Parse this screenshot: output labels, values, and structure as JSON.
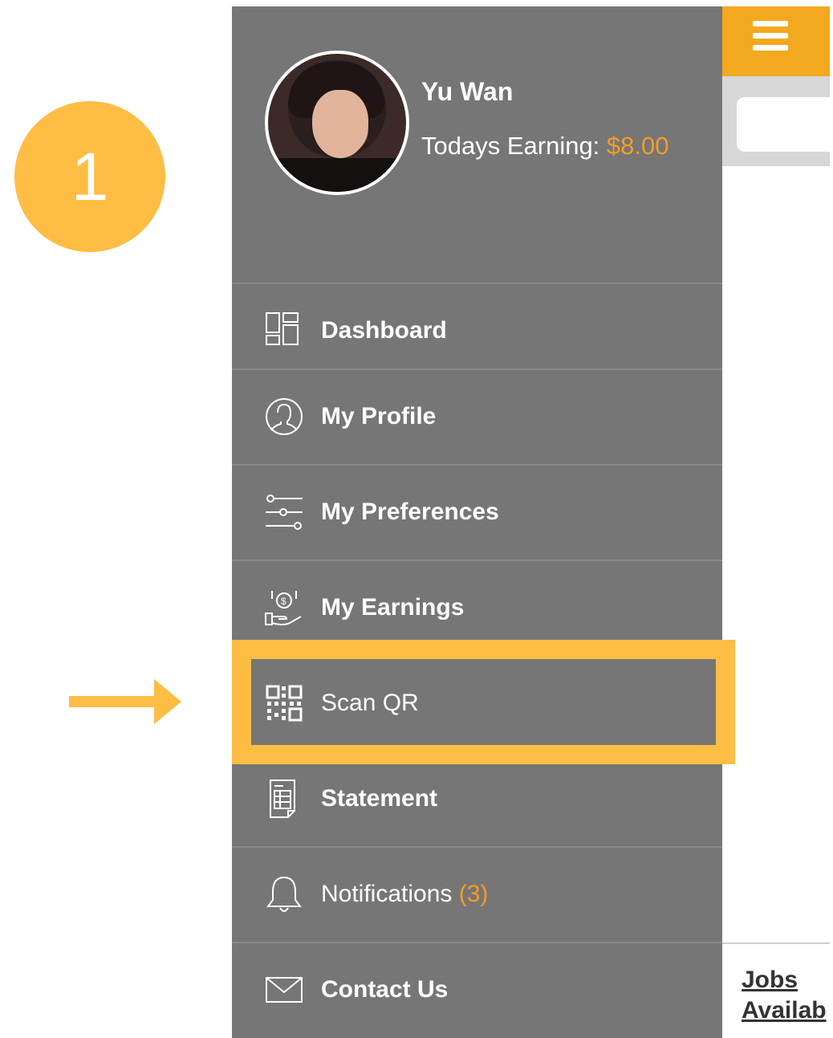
{
  "step": {
    "number": "1"
  },
  "user": {
    "name": "Yu Wan",
    "earning_label": "Todays Earning: ",
    "earning_amount": "$8.00"
  },
  "menu": [
    {
      "label": "Dashboard",
      "icon": "dashboard-icon"
    },
    {
      "label": "My Profile",
      "icon": "profile-icon"
    },
    {
      "label": "My Preferences",
      "icon": "sliders-icon"
    },
    {
      "label": "My Earnings",
      "icon": "earnings-icon"
    },
    {
      "label": "Scan QR",
      "icon": "qr-code-icon"
    },
    {
      "label": "Statement",
      "icon": "statement-icon"
    },
    {
      "label": "Notifications ",
      "count": "(3)",
      "icon": "bell-icon"
    },
    {
      "label": "Contact Us",
      "icon": "envelope-icon"
    }
  ],
  "background_app": {
    "jobs_link": "Jobs\nAvailab"
  },
  "colors": {
    "accent": "#FFBD44",
    "header": "#F2A91F",
    "drawer": "#767676",
    "earning": "#F39C2A"
  }
}
